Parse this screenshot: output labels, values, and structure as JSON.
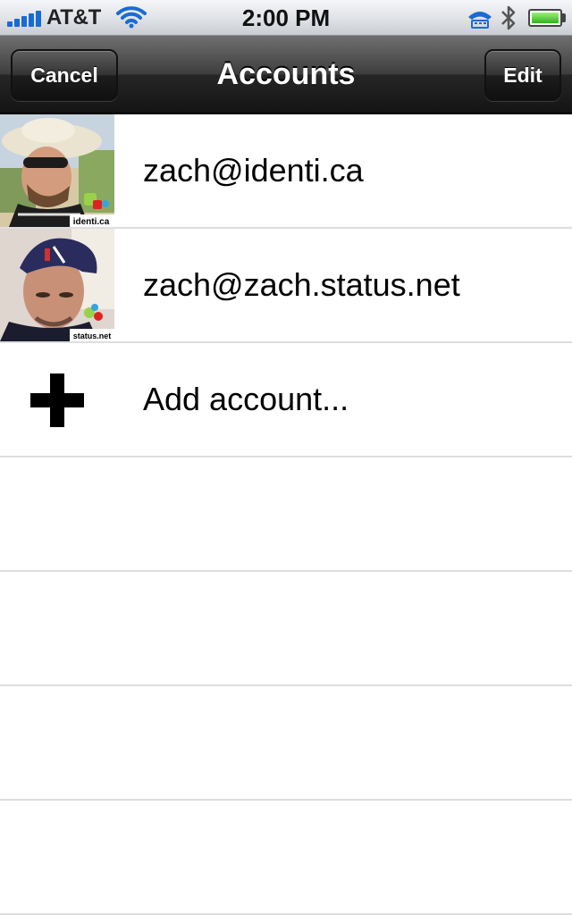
{
  "status_bar": {
    "carrier": "AT&T",
    "time": "2:00 PM",
    "icons": [
      "signal-bars-icon",
      "wifi-icon",
      "tty-icon",
      "bluetooth-icon",
      "battery-icon"
    ],
    "signal_color": "#1a6bd1"
  },
  "nav": {
    "title": "Accounts",
    "cancel_label": "Cancel",
    "edit_label": "Edit"
  },
  "accounts": [
    {
      "label": "zach@identi.ca",
      "badge": "identi.ca",
      "icon": "avatar-identica-icon"
    },
    {
      "label": "zach@zach.status.net",
      "badge": "status.net",
      "icon": "avatar-statusnet-icon"
    }
  ],
  "add_account": {
    "label": "Add account...",
    "icon": "plus-icon"
  },
  "colors": {
    "nav_bar": "#262626",
    "separator": "#dedede",
    "background": "#ffffff"
  }
}
